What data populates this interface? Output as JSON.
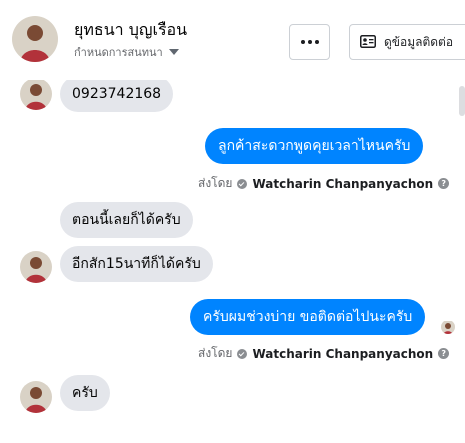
{
  "header": {
    "contact_name": "ยุทธนา บุญเรือน",
    "manage_chat_label": "กำหนดการสนทนา",
    "contact_info_button_label": "ดูข้อมูลติดต่อ",
    "more_icon": "more-horizontal-icon",
    "contact_card_icon": "contact-card-icon"
  },
  "messages": [
    {
      "direction": "incoming",
      "text": "0923742168"
    },
    {
      "direction": "outgoing",
      "text": "ลูกค้าสะดวกพูดคุยเวลาไหนครับ"
    },
    {
      "direction": "incoming",
      "text": "ตอนนี้เลยก็ได้ครับ"
    },
    {
      "direction": "incoming",
      "text": "อีกสัก15นาทีก็ได้ครับ"
    },
    {
      "direction": "outgoing",
      "text": "ครับผมช่วงบ่าย ขอติดต่อไปนะครับ"
    },
    {
      "direction": "incoming",
      "text": "ครับ"
    }
  ],
  "sent_by": {
    "prefix": "ส่งโดย",
    "sender": "Watcharin Chanpanyachon",
    "verified_icon": "check-circle-icon",
    "help_icon": "question-circle-icon",
    "help_glyph": "?"
  },
  "colors": {
    "outgoing_bubble": "#0084ff",
    "incoming_bubble": "#e4e6eb",
    "secondary_text": "#65676b"
  }
}
